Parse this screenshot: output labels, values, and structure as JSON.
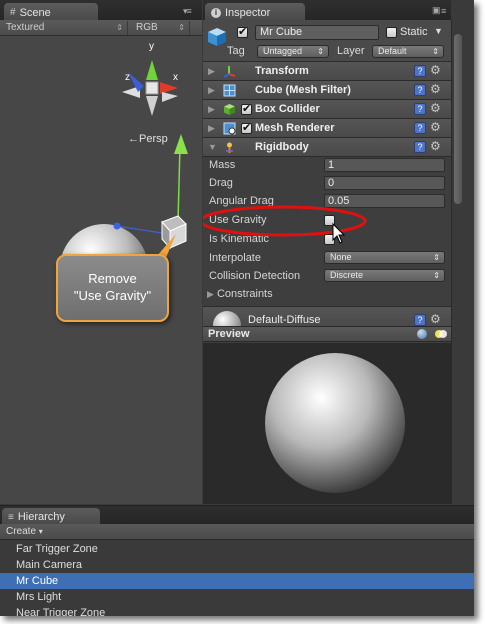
{
  "scene": {
    "tab_label": "Scene",
    "shading_mode": "Textured",
    "render_mode": "RGB",
    "gizmo_labels": {
      "y": "y",
      "x": "x",
      "z": "z"
    },
    "projection_label": "Persp"
  },
  "callout": {
    "line1": "Remove",
    "line2": "\"Use Gravity\""
  },
  "inspector": {
    "tab_label": "Inspector",
    "object_name": "Mr Cube",
    "object_active": true,
    "static_label": "Static",
    "static_checked": false,
    "tag_label": "Tag",
    "tag_value": "Untagged",
    "layer_label": "Layer",
    "layer_value": "Default",
    "components": [
      {
        "title": "Transform",
        "icon": "transform-icon",
        "has_checkbox": false,
        "expanded": false
      },
      {
        "title": "Cube (Mesh Filter)",
        "icon": "mesh-filter-icon",
        "has_checkbox": false,
        "expanded": false
      },
      {
        "title": "Box Collider",
        "icon": "box-collider-icon",
        "has_checkbox": true,
        "checked": true,
        "expanded": false
      },
      {
        "title": "Mesh Renderer",
        "icon": "mesh-renderer-icon",
        "has_checkbox": true,
        "checked": true,
        "expanded": false
      },
      {
        "title": "Rigidbody",
        "icon": "rigidbody-icon",
        "has_checkbox": false,
        "expanded": true
      }
    ],
    "rigidbody": {
      "mass_label": "Mass",
      "mass": "1",
      "drag_label": "Drag",
      "drag": "0",
      "angular_drag_label": "Angular Drag",
      "angular_drag": "0.05",
      "use_gravity_label": "Use Gravity",
      "use_gravity": false,
      "is_kinematic_label": "Is Kinematic",
      "is_kinematic": false,
      "interpolate_label": "Interpolate",
      "interpolate": "None",
      "collision_detection_label": "Collision Detection",
      "collision_detection": "Discrete",
      "constraints_label": "Constraints"
    },
    "material_name": "Default-Diffuse",
    "preview_label": "Preview"
  },
  "hierarchy": {
    "tab_label": "Hierarchy",
    "create_label": "Create",
    "items": [
      "Far Trigger Zone",
      "Main Camera",
      "Mr Cube",
      "Mrs Light",
      "Near Trigger Zone"
    ],
    "selected_index": 2
  },
  "colors": {
    "selection": "#3e6fb5",
    "callout_border": "#f0a43a",
    "highlight_ellipse": "#e01010",
    "help_icon": "#4d74c7"
  }
}
